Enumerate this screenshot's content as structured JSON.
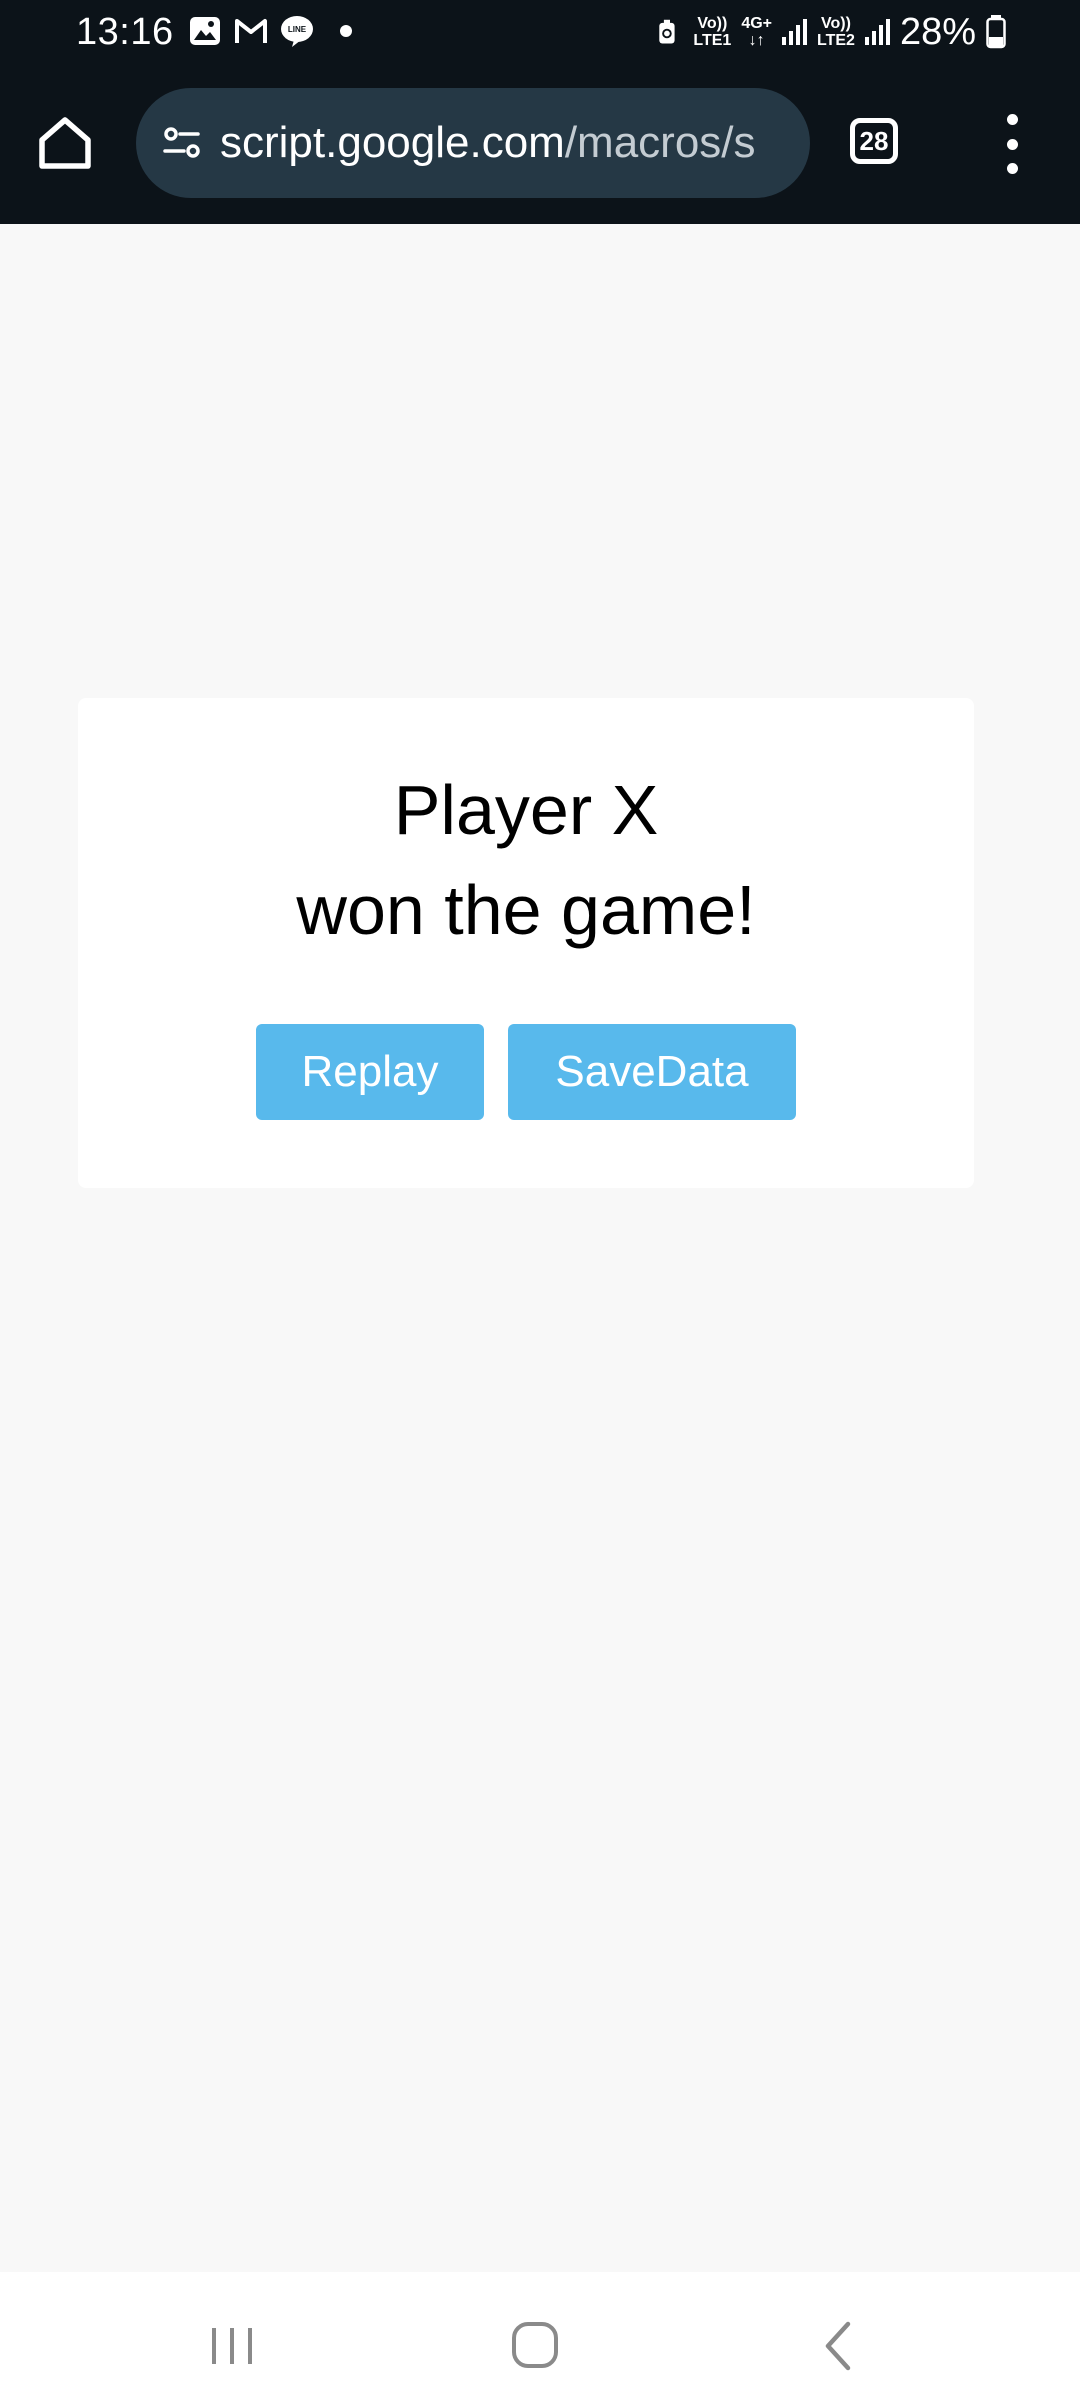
{
  "status_bar": {
    "time": "13:16",
    "sim1_label_top": "Vo))",
    "sim1_label_bottom": "LTE1",
    "network_type": "4G+",
    "sim2_label_top": "Vo))",
    "sim2_label_bottom": "LTE2",
    "battery_percent": "28%",
    "icons": [
      "gallery-icon",
      "gmail-icon",
      "line-icon",
      "notification-dot-icon",
      "battery-saver-icon",
      "signal-icon",
      "battery-icon"
    ]
  },
  "browser": {
    "home_icon": "home-icon",
    "site_settings_icon": "tune-icon",
    "url_host": "script.google.com",
    "url_path": "/macros/s",
    "tab_count": "28",
    "menu_icon": "more-vert-icon"
  },
  "dialog": {
    "line1": "Player X",
    "line2": "won the game!",
    "replay_label": "Replay",
    "save_label": "SaveData"
  },
  "nav_bar": {
    "icons": [
      "recent-apps-icon",
      "home-button-icon",
      "back-icon"
    ]
  },
  "colors": {
    "top_bar": "#0c1319",
    "omnibox": "#253845",
    "page_background": "#f8f8f8",
    "button": "#58b9ec"
  }
}
